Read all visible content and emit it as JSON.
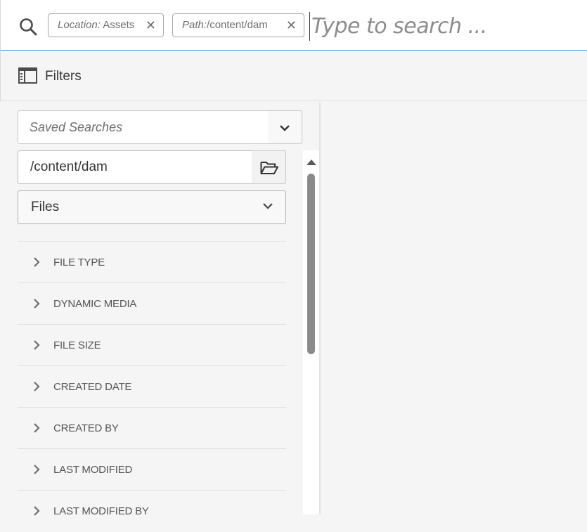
{
  "search": {
    "placeholder": "Type to search ...",
    "tags": [
      {
        "key": "Location:",
        "value": " Assets"
      },
      {
        "key": "Path:",
        "value": "/content/dam"
      }
    ]
  },
  "filters": {
    "title": "Filters",
    "saved_searches_placeholder": "Saved Searches",
    "path_value": "/content/dam",
    "type_select": "Files",
    "facets": [
      "FILE TYPE",
      "DYNAMIC MEDIA",
      "FILE SIZE",
      "CREATED DATE",
      "CREATED BY",
      "LAST MODIFIED",
      "LAST MODIFIED BY"
    ]
  },
  "icons": {
    "search": "search-icon",
    "remove_tag": "close-icon",
    "filters": "sidebar-panel-icon",
    "dropdown": "chevron-down-icon",
    "folder": "folder-open-icon",
    "facet_expand": "chevron-right-icon"
  },
  "colors": {
    "focus_border": "#4b9bd6",
    "background": "#f5f5f5",
    "scroll_thumb": "#8a8a8a"
  }
}
